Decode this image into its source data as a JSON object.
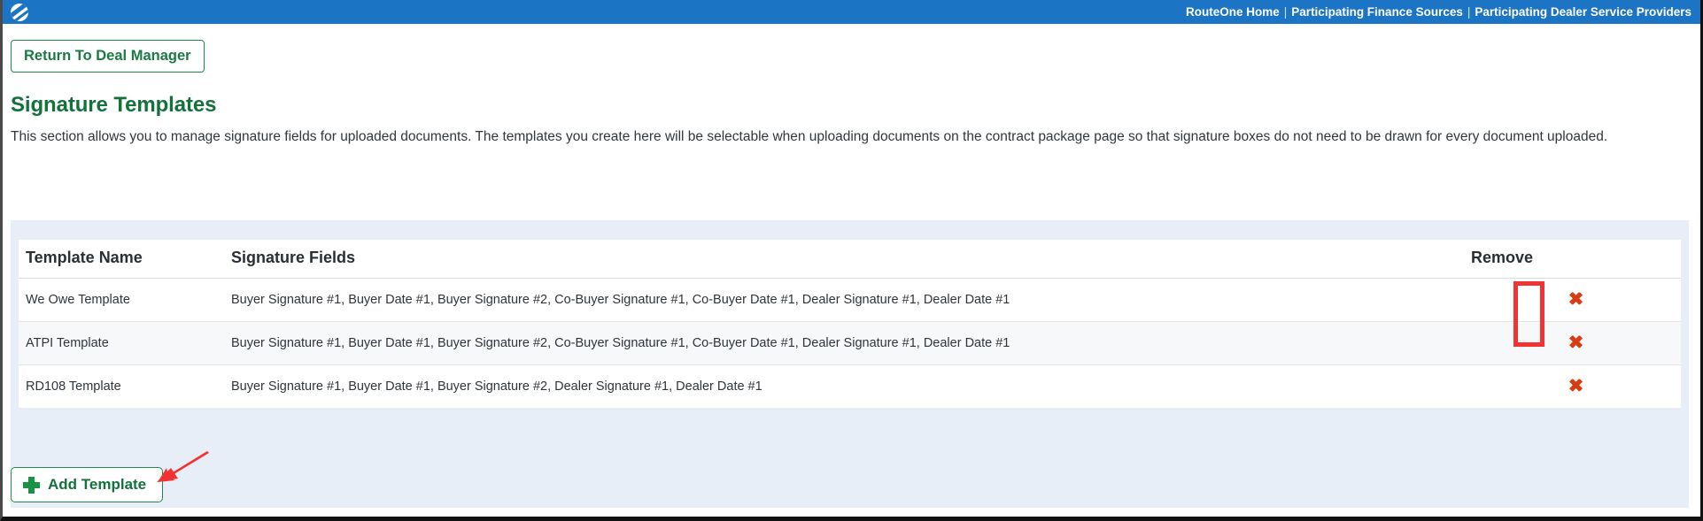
{
  "topbar": {
    "logo_name": "routeone-logo-icon",
    "links": [
      {
        "label": "RouteOne Home"
      },
      {
        "label": "Participating Finance Sources"
      },
      {
        "label": "Participating Dealer Service Providers"
      }
    ],
    "separator": "|",
    "background_color": "#1c74c4"
  },
  "return_button": {
    "label": "Return To Deal Manager",
    "accent_color": "#1a7a43"
  },
  "page": {
    "title": "Signature Templates",
    "title_color": "#13713b",
    "description": "This section allows you to manage signature fields for uploaded documents. The templates you create here will be selectable when uploading documents on the contract package page so that signature boxes do not need to be drawn for every document uploaded."
  },
  "table": {
    "headers": {
      "name": "Template Name",
      "fields": "Signature Fields",
      "remove": "Remove"
    },
    "remove_icon": "red-x-icon",
    "remove_icon_glyph": "✖",
    "remove_icon_color": "#d93c12",
    "rows": [
      {
        "name": "We Owe Template",
        "fields": "Buyer Signature #1, Buyer Date #1, Buyer Signature #2, Co-Buyer Signature #1, Co-Buyer Date #1, Dealer Signature #1, Dealer Date #1"
      },
      {
        "name": "ATPI Template",
        "fields": "Buyer Signature #1, Buyer Date #1, Buyer Signature #2, Co-Buyer Signature #1, Co-Buyer Date #1, Dealer Signature #1, Dealer Date #1"
      },
      {
        "name": "RD108 Template",
        "fields": "Buyer Signature #1, Buyer Date #1, Buyer Signature #2, Dealer Signature #1, Dealer Date #1"
      }
    ]
  },
  "add_button": {
    "label": "Add Template",
    "icon": "green-plus-icon",
    "accent_color": "#13713b"
  },
  "annotations": {
    "highlight_color": "#f23333",
    "arrow_color": "#f23333"
  }
}
